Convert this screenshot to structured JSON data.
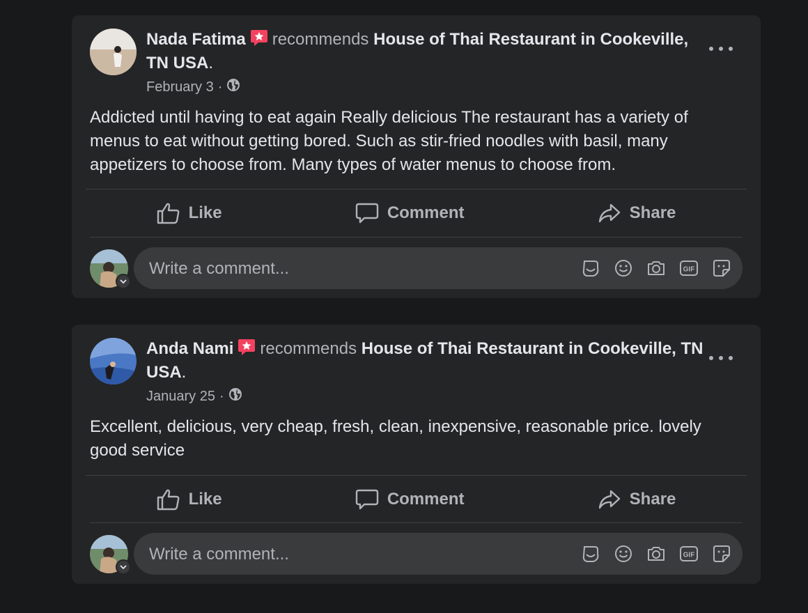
{
  "posts": [
    {
      "author": "Nada Fatima",
      "verb": "recommends",
      "place": "House of Thai Restaurant in Cookeville, TN USA",
      "place_suffix": ".",
      "date": "February 3",
      "dot": "·",
      "text": "Addicted until having to eat again Really delicious The restaurant has a variety of menus to eat without getting bored. Such as stir-fried noodles with basil, many appetizers to choose from. Many types of water menus to choose from."
    },
    {
      "author": "Anda Nami",
      "verb": "recommends",
      "place": "House of Thai Restaurant in Cookeville, TN USA",
      "place_suffix": ".",
      "date": "January 25",
      "dot": "·",
      "text": "Excellent, delicious, very cheap, fresh, clean, inexpensive, reasonable price. lovely good service"
    }
  ],
  "actions": {
    "like": "Like",
    "comment": "Comment",
    "share": "Share"
  },
  "comment_placeholder": "Write a comment...",
  "icons": {
    "recommend": "recommend-star-icon",
    "privacy": "globe-icon",
    "more": "more-options-icon",
    "like": "thumbs-up-icon",
    "comment": "speech-bubble-icon",
    "share": "share-arrow-icon",
    "tools": [
      "avatar-sticker-icon",
      "emoji-icon",
      "camera-icon",
      "gif-icon",
      "sticker-icon"
    ]
  },
  "colors": {
    "page_bg": "#18191a",
    "card_bg": "#242526",
    "input_bg": "#3a3b3c",
    "text_primary": "#e4e6eb",
    "text_secondary": "#b0b3b8",
    "recommend_badge": "#f3425f"
  }
}
